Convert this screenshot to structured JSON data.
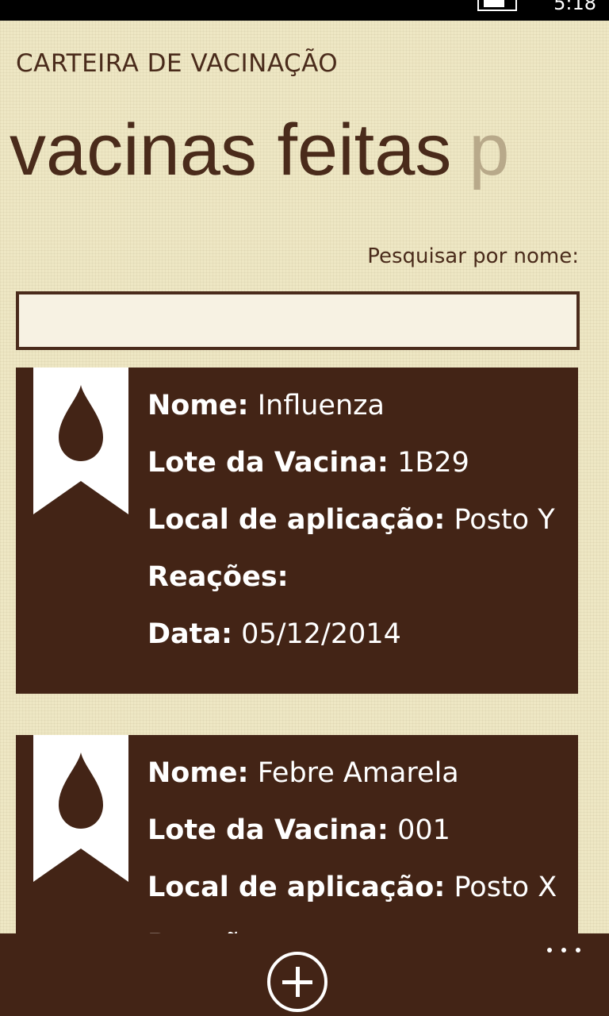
{
  "status": {
    "time": "5:18"
  },
  "app": {
    "title": "CARTEIRA DE VACINAÇÃO"
  },
  "pivot": {
    "items": [
      {
        "label": "vacinas feitas"
      },
      {
        "label": "p"
      }
    ]
  },
  "search": {
    "label": "Pesquisar por nome:",
    "value": "",
    "placeholder": ""
  },
  "labels": {
    "nome": "Nome:",
    "lote": "Lote da Vacina:",
    "local": "Local de aplicação:",
    "reacoes": "Reações:",
    "data": "Data:"
  },
  "vaccines": [
    {
      "nome": "Influenza",
      "lote": "1B29",
      "local": "Posto Y",
      "reacoes": "",
      "data": "05/12/2014"
    },
    {
      "nome": "Febre Amarela",
      "lote": "001",
      "local": "Posto X",
      "reacoes": "",
      "data": ""
    }
  ],
  "appbar": {
    "add_icon": "add-circle-icon",
    "more_icon": "more-ellipsis-icon"
  },
  "colors": {
    "accent": "#432416",
    "background": "#EEE7C4",
    "text": "#4A2B1B",
    "inactive": "#B8A98A"
  }
}
